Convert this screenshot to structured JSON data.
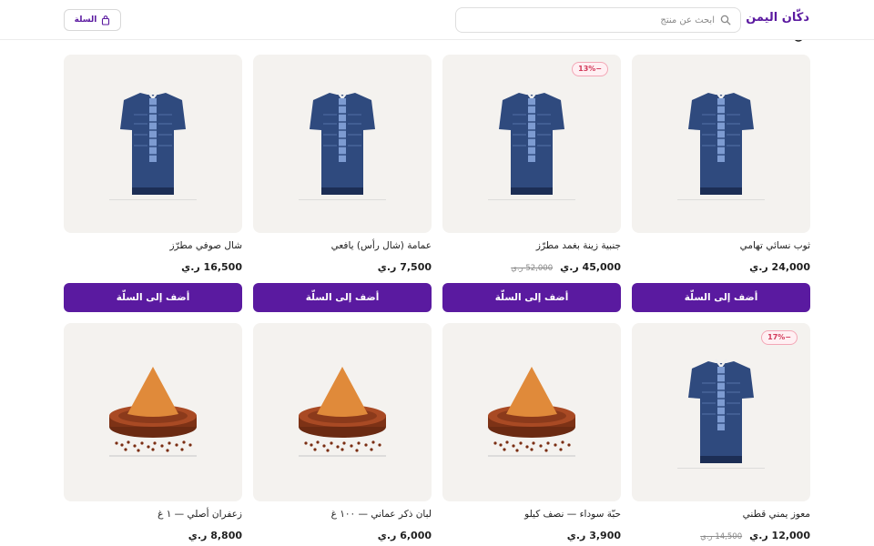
{
  "header": {
    "brand": "دكّان اليمن",
    "search_placeholder": "ابحث عن منتج",
    "cart_label": "السلة"
  },
  "colors": {
    "accent": "#5a1aa0",
    "badge": "#d23a5a",
    "thumb_bg": "#f4f2ef"
  },
  "products": [
    {
      "name": "ثوب نسائي تهامي",
      "price": "24,000 ر.ي",
      "old_price": "",
      "badge": "",
      "image": "dress-icon",
      "add_label": "أضف إلى السلّة"
    },
    {
      "name": "جنبية زينة بغمد مطرّز",
      "price": "45,000 ر.ي",
      "old_price": "52,000 ر.ي",
      "badge": "13%−",
      "image": "dress-icon",
      "add_label": "أضف إلى السلّة"
    },
    {
      "name": "عمامة (شال رأس) يافعي",
      "price": "7,500 ر.ي",
      "old_price": "",
      "badge": "",
      "image": "dress-icon",
      "add_label": "أضف إلى السلّة"
    },
    {
      "name": "شال صوفي مطرّز",
      "price": "16,500 ر.ي",
      "old_price": "",
      "badge": "",
      "image": "dress-icon",
      "add_label": "أضف إلى السلّة"
    },
    {
      "name": "معوز يمني قطني",
      "price": "12,000 ر.ي",
      "old_price": "14,500 ر.ي",
      "badge": "17%−",
      "image": "dress-icon",
      "add_label": ""
    },
    {
      "name": "حبّة سوداء — نصف كيلو",
      "price": "3,900 ر.ي",
      "old_price": "",
      "badge": "",
      "image": "spice-pile-icon",
      "add_label": ""
    },
    {
      "name": "لبان ذكر عماني — ١٠٠ غ",
      "price": "6,000 ر.ي",
      "old_price": "",
      "badge": "",
      "image": "spice-pile-icon",
      "add_label": ""
    },
    {
      "name": "زعفران أصلي — ١ غ",
      "price": "8,800 ر.ي",
      "old_price": "",
      "badge": "",
      "image": "spice-pile-icon",
      "add_label": ""
    }
  ]
}
